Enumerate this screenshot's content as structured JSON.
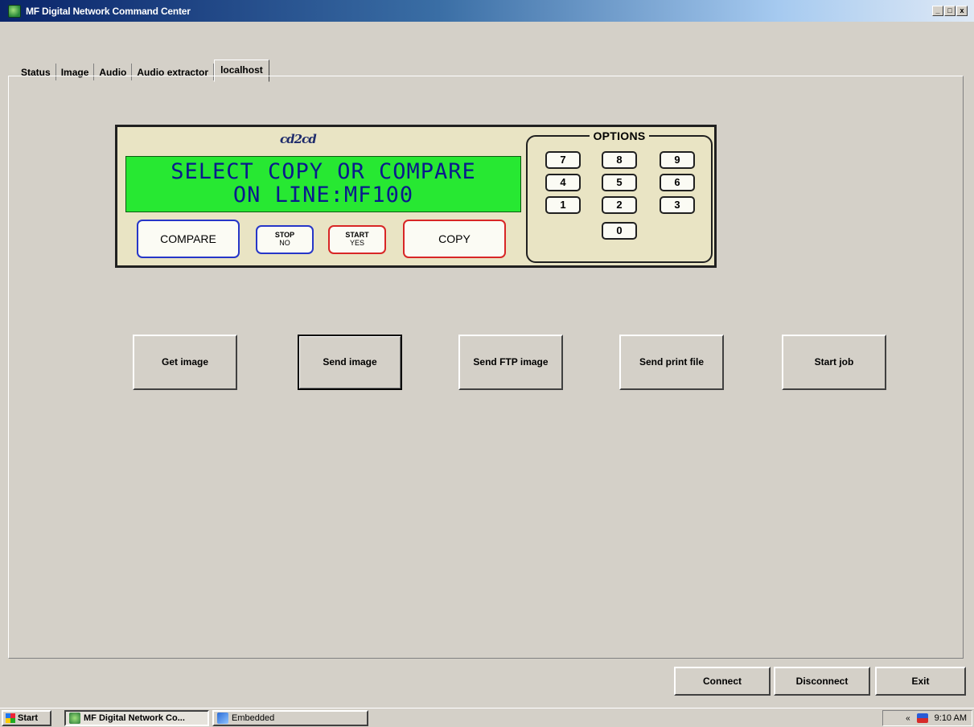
{
  "window": {
    "title": "MF Digital Network Command Center",
    "controls": {
      "minimize": "_",
      "maximize": "□",
      "close": "x"
    }
  },
  "tabs": [
    {
      "label": "Status",
      "active": false
    },
    {
      "label": "Image",
      "active": false
    },
    {
      "label": "Audio",
      "active": false
    },
    {
      "label": "Audio extractor",
      "active": false
    },
    {
      "label": "localhost",
      "active": true
    }
  ],
  "device": {
    "logo": "cd2cd",
    "lcd": {
      "line1": "SELECT COPY OR COMPARE",
      "line2": "ON LINE:MF100",
      "background": "#27e832",
      "text_color": "#0a1a8c"
    },
    "buttons": {
      "compare": "COMPARE",
      "stop_top": "STOP",
      "stop_bottom": "NO",
      "start_top": "START",
      "start_bottom": "YES",
      "copy": "COPY"
    },
    "options_title": "OPTIONS",
    "keys": [
      "7",
      "8",
      "9",
      "4",
      "5",
      "6",
      "1",
      "2",
      "3",
      "0"
    ]
  },
  "actions": {
    "get_image": "Get image",
    "send_image": "Send image",
    "send_ftp_image": "Send FTP image",
    "send_print_file": "Send print file",
    "start_job": "Start job"
  },
  "bottom": {
    "connect": "Connect",
    "disconnect": "Disconnect",
    "exit": "Exit"
  },
  "taskbar": {
    "start": "Start",
    "tasks": [
      "MF Digital Network Co...",
      "Embedded"
    ],
    "tray_chevron": "«",
    "clock": "9:10 AM"
  }
}
